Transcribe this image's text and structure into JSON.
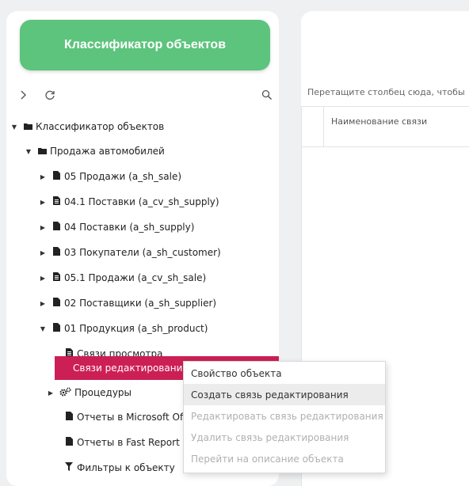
{
  "left_panel": {
    "header_button": "Классификатор объектов",
    "toolbar": {
      "expand_icon": "chevron-right-icon",
      "refresh_icon": "refresh-icon",
      "search_icon": "search-icon"
    },
    "tree": [
      {
        "label": "Классификатор объектов",
        "icon": "folder-icon",
        "arrow": "expanded"
      },
      {
        "label": "Продажа автомобилей",
        "icon": "folder-icon",
        "arrow": "expanded"
      },
      {
        "label": "05 Продажи (a_sh_sale)",
        "icon": "file-icon",
        "arrow": "collapsed"
      },
      {
        "label": "04.1 Поставки (a_cv_sh_supply)",
        "icon": "view-icon",
        "arrow": "collapsed"
      },
      {
        "label": "04 Поставки (a_sh_supply)",
        "icon": "file-icon",
        "arrow": "collapsed"
      },
      {
        "label": "03 Покупатели (a_sh_customer)",
        "icon": "file-icon",
        "arrow": "collapsed"
      },
      {
        "label": "05.1 Продажи (a_cv_sh_sale)",
        "icon": "view-icon",
        "arrow": "collapsed"
      },
      {
        "label": "02 Поставщики (a_sh_supplier)",
        "icon": "file-icon",
        "arrow": "collapsed"
      },
      {
        "label": "01 Продукция (a_sh_product)",
        "icon": "file-icon",
        "arrow": "expanded"
      },
      {
        "label": "Связи просмотра",
        "icon": "view-icon",
        "arrow": "none"
      },
      {
        "label": "Связи редактирования",
        "icon": "none",
        "arrow": "none",
        "selected": true
      },
      {
        "label": "Процедуры",
        "icon": "gears-icon",
        "arrow": "collapsed"
      },
      {
        "label": "Отчеты в Microsoft Office",
        "icon": "file-icon",
        "arrow": "none"
      },
      {
        "label": "Отчеты в Fast Report",
        "icon": "file-icon",
        "arrow": "none"
      },
      {
        "label": "Фильтры к объекту",
        "icon": "filter-icon",
        "arrow": "none"
      }
    ]
  },
  "right_panel": {
    "drag_hint": "Перетащите столбец сюда, чтобы",
    "column_header": "Наименование связи"
  },
  "context_menu": {
    "items": [
      {
        "label": "Свойство объекта",
        "state": "normal"
      },
      {
        "label": "Создать связь редактирования",
        "state": "hover"
      },
      {
        "label": "Редактировать связь редактирования",
        "state": "disabled"
      },
      {
        "label": "Удалить связь редактирования",
        "state": "disabled"
      },
      {
        "label": "Перейти на описание объекта",
        "state": "disabled"
      }
    ]
  },
  "colors": {
    "accent_green": "#5cc47c",
    "selected_row": "#cc1f55"
  }
}
